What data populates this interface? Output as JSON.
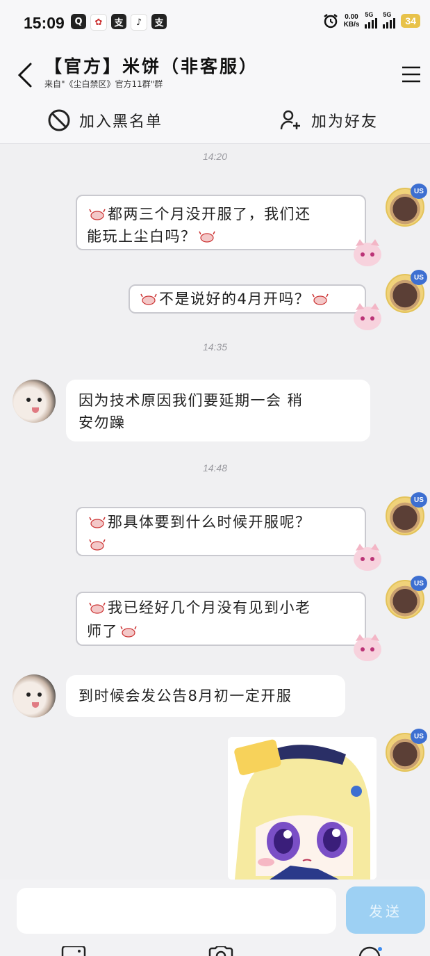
{
  "status_bar": {
    "time": "15:09",
    "speed_value": "0.00",
    "speed_unit": "KB/s",
    "network1": "5G",
    "network2": "5G",
    "battery": "34"
  },
  "header": {
    "title": "【官方】米饼（非客服）",
    "subtitle": "来自\"《尘白禁区》官方11群\"群"
  },
  "actions": {
    "block_label": "加入黑名单",
    "add_friend_label": "加为好友"
  },
  "messages": [
    {
      "type": "timestamp",
      "text": "14:20"
    },
    {
      "type": "out",
      "text": "都两三个月没开服了，我们还能玩上尘白吗？"
    },
    {
      "type": "out",
      "text": "不是说好的4月开吗？"
    },
    {
      "type": "timestamp",
      "text": "14:35"
    },
    {
      "type": "in",
      "text_line1": "因为技术原因我们要延期一会 稍",
      "text_line2": "安勿躁"
    },
    {
      "type": "timestamp",
      "text": "14:48"
    },
    {
      "type": "out",
      "text": "那具体要到什么时候开服呢？"
    },
    {
      "type": "out",
      "text_line1": "我已经好几个月没有见到小老",
      "text_line2": "师了"
    },
    {
      "type": "in",
      "text": "到时候会发公告8月初一定开服"
    }
  ],
  "bubbles": {
    "m1_line1": "都两三个月没开服了，我们还",
    "m1_line2": "能玩上尘白吗？",
    "m2": "不是说好的4月开吗？",
    "m4_line1": "那具体要到什么时候开服呢？",
    "m5_line1": "我已经好几个月没有见到小老",
    "m5_line2": "师了"
  },
  "badge_label": "US",
  "input": {
    "placeholder": "",
    "send_label": "发送"
  },
  "colors": {
    "background": "#f0f0f2",
    "send_button": "#9dd0f3",
    "bubble_border": "#c9c9cf"
  }
}
